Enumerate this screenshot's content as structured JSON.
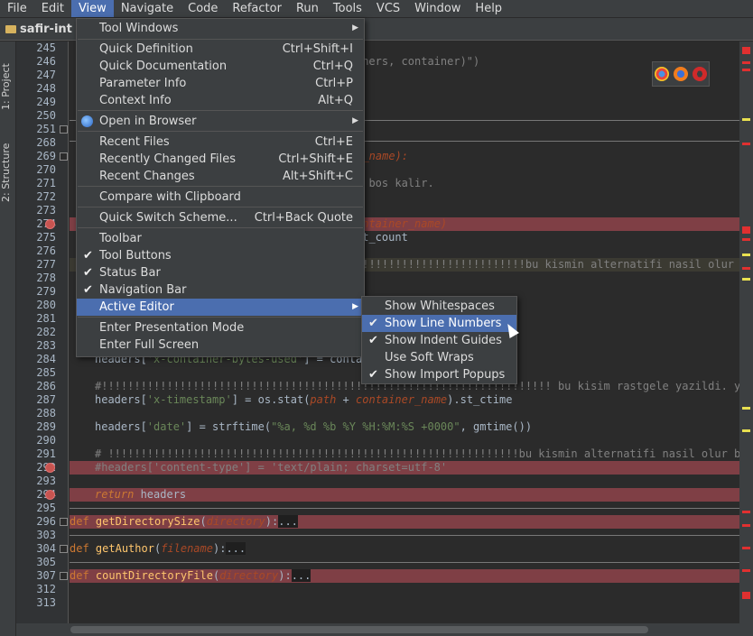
{
  "menubar": [
    "File",
    "Edit",
    "View",
    "Navigate",
    "Code",
    "Refactor",
    "Run",
    "Tools",
    "VCS",
    "Window",
    "Help"
  ],
  "nav_tab": "safir-int",
  "left_tabs": [
    "1: Project",
    "2: Structure"
  ],
  "gutter_lines": [
    "245",
    "246",
    "247",
    "248",
    "249",
    "250",
    "251",
    "268",
    "269",
    "270",
    "271",
    "272",
    "273",
    "274",
    "275",
    "276",
    "277",
    "278",
    "279",
    "280",
    "281",
    "282",
    "283",
    "284",
    "285",
    "286",
    "287",
    "288",
    "289",
    "290",
    "291",
    "292",
    "293",
    "294",
    "295",
    "296",
    "303",
    "304",
    "305",
    "307",
    "312",
    "313"
  ],
  "code": {
    "l246": "#                    :Exists(self, containers, container)\")",
    "l251": "d",
    "l269_kw": "d",
    "l269": "r_name):",
    "l271": "m bos kalir.",
    "l274": "ontainer_name)",
    "l275": "ct_count",
    "l277": "!!!!!!!!!!!!!!!!!!!!!!!!!!bu kismin alternatifi nasil olur b",
    "l284a": "headers[",
    "l284s": "'x-container-bytes-used'",
    "l284b": "] = contai",
    "l286": "#!!!!!!!!!!!!!!!!!!!!!!!!!!!!!!!!!!!!!!!!!!!!!!!!!!!!!!!!!!!!!!!!!!!!! bu kisim rastgele yazildi. yanlis olma",
    "l287a": "headers[",
    "l287s": "'x-timestamp'",
    "l287b": "] = os.stat(",
    "l287p": "path",
    "l287c": " + ",
    "l287d": "container_name",
    "l287e": ").st_ctime",
    "l289a": "headers[",
    "l289s": "'date'",
    "l289b": "] = strftime(",
    "l289f": "\"%a, %d %b %Y %H:%M:%S +0000\"",
    "l289c": ", gmtime())",
    "l291": "# !!!!!!!!!!!!!!!!!!!!!!!!!!!!!!!!!!!!!!!!!!!!!!!!!!!!!!!!!!!!!!!bu kismin alternatifi nasil olur b",
    "l292": "#headers['content-type'] = 'text/plain; charset=utf-8'",
    "l294_kw": "return",
    "l294": " headers",
    "l296_kw": "def",
    "l296_fn": "getDirectorySize",
    "l296_p": "directory",
    "l304_kw": "def",
    "l304_fn": "getAuthor",
    "l304_p": "filename",
    "l307_kw": "def",
    "l307_fn": "countDirectoryFile",
    "l307_p": "directory",
    "ellipsis": "..."
  },
  "view_menu": {
    "tool_windows": "Tool Windows",
    "quick_definition": "Quick Definition",
    "quick_definition_sc": "Ctrl+Shift+I",
    "quick_documentation": "Quick Documentation",
    "quick_documentation_sc": "Ctrl+Q",
    "parameter_info": "Parameter Info",
    "parameter_info_sc": "Ctrl+P",
    "context_info": "Context Info",
    "context_info_sc": "Alt+Q",
    "open_in_browser": "Open in Browser",
    "recent_files": "Recent Files",
    "recent_files_sc": "Ctrl+E",
    "recently_changed_files": "Recently Changed Files",
    "recently_changed_files_sc": "Ctrl+Shift+E",
    "recent_changes": "Recent Changes",
    "recent_changes_sc": "Alt+Shift+C",
    "compare_with_clipboard": "Compare with Clipboard",
    "quick_switch_scheme": "Quick Switch Scheme...",
    "quick_switch_scheme_sc": "Ctrl+Back Quote",
    "toolbar": "Toolbar",
    "tool_buttons": "Tool Buttons",
    "status_bar": "Status Bar",
    "navigation_bar": "Navigation Bar",
    "active_editor": "Active Editor",
    "enter_presentation_mode": "Enter Presentation Mode",
    "enter_full_screen": "Enter Full Screen"
  },
  "submenu": {
    "show_whitespaces": "Show Whitespaces",
    "show_line_numbers": "Show Line Numbers",
    "show_indent_guides": "Show Indent Guides",
    "use_soft_wraps": "Use Soft Wraps",
    "show_import_popups": "Show Import Popups"
  },
  "checkmark": "✔",
  "arrow": "▶",
  "colors": {
    "highlight": "#4b6eaf",
    "breakpoint": "#c75450",
    "error_line": "#7f3f45"
  }
}
